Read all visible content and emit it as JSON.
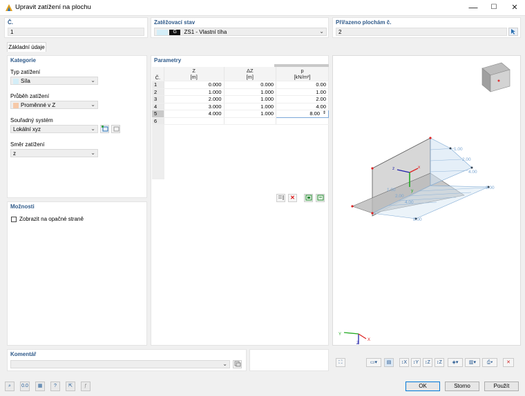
{
  "window": {
    "title": "Upravit zatížení na plochu",
    "min": "—",
    "max": "☐",
    "close": "✕"
  },
  "header": {
    "no_label": "Č.",
    "no_value": "1",
    "loadcase_label": "Zatěžovací stav",
    "loadcase_badge": "G",
    "loadcase_value": "ZS1 - Vlastní tíha",
    "assigned_label": "Přiřazeno plochám č.",
    "assigned_value": "2"
  },
  "tabs": [
    {
      "label": "Základní údaje"
    }
  ],
  "kategorie": {
    "title": "Kategorie",
    "load_type_label": "Typ zatížení",
    "load_type_value": "Síla",
    "load_type_color": "#d4eef8",
    "distribution_label": "Průběh zatížení",
    "distribution_value": "Proměnné v Z",
    "distribution_color": "#f6c9a8",
    "coord_label": "Souřadný systém",
    "coord_value": "Lokální xyz",
    "direction_label": "Směr zatížení",
    "direction_value": "z"
  },
  "moznosti": {
    "title": "Možnosti",
    "show_opposite_label": "Zobrazit na opačné straně"
  },
  "parametry": {
    "title": "Parametry",
    "columns": [
      {
        "label": "Č.",
        "unit": ""
      },
      {
        "label": "Z",
        "unit": "[m]"
      },
      {
        "label": "ΔZ",
        "unit": "[m]"
      },
      {
        "label": "p",
        "unit": "[kN/m²]"
      }
    ],
    "rows": [
      {
        "no": "1",
        "z": "0.000",
        "dz": "0.000",
        "p": "0.00"
      },
      {
        "no": "2",
        "z": "1.000",
        "dz": "1.000",
        "p": "1.00"
      },
      {
        "no": "3",
        "z": "2.000",
        "dz": "1.000",
        "p": "2.00"
      },
      {
        "no": "4",
        "z": "3.000",
        "dz": "1.000",
        "p": "4.00"
      },
      {
        "no": "5",
        "z": "4.000",
        "dz": "1.000",
        "p": "8.00"
      },
      {
        "no": "6",
        "z": "",
        "dz": "",
        "p": ""
      }
    ]
  },
  "viewport": {
    "load_labels": [
      "1.00",
      "2.00",
      "4.00",
      "8.00",
      "1.00",
      "2.00",
      "4.00",
      "8.00"
    ],
    "axis_x": "x",
    "axis_y": "y",
    "axis_z": "z",
    "triad_x": "X",
    "triad_y": "Y",
    "triad_z": "Z"
  },
  "komentar": {
    "title": "Komentář",
    "value": ""
  },
  "buttons": {
    "ok": "OK",
    "storno": "Storno",
    "pouzit": "Použít"
  },
  "colors": {
    "accent": "#2f5a8a",
    "ok_border": "#0078d7"
  }
}
